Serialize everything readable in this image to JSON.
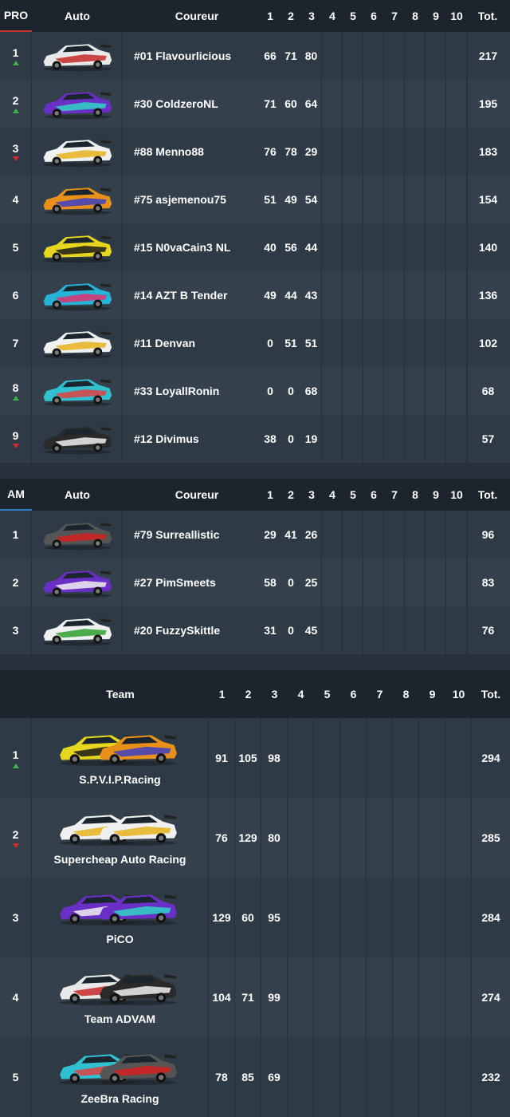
{
  "pro": {
    "header": {
      "category": "PRO",
      "auto": "Auto",
      "coureur": "Coureur",
      "races": [
        "1",
        "2",
        "3",
        "4",
        "5",
        "6",
        "7",
        "8",
        "9",
        "10"
      ],
      "total": "Tot."
    },
    "rows": [
      {
        "pos": "1",
        "trend": "up",
        "driver": "#01 Flavourlicious",
        "scores": [
          "66",
          "71",
          "80"
        ],
        "total": "217",
        "car": {
          "body": "#e8e8e8",
          "accent": "#c62828"
        }
      },
      {
        "pos": "2",
        "trend": "up",
        "driver": "#30 ColdzeroNL",
        "scores": [
          "71",
          "60",
          "64"
        ],
        "total": "195",
        "car": {
          "body": "#6a2fc4",
          "accent": "#2ed3c5"
        }
      },
      {
        "pos": "3",
        "trend": "down",
        "driver": "#88 Menno88",
        "scores": [
          "76",
          "78",
          "29"
        ],
        "total": "183",
        "car": {
          "body": "#f0f0f0",
          "accent": "#e6b41e"
        }
      },
      {
        "pos": "4",
        "trend": "none",
        "driver": "#75 asjemenou75",
        "scores": [
          "51",
          "49",
          "54"
        ],
        "total": "154",
        "car": {
          "body": "#e8901a",
          "accent": "#3d3fc4"
        }
      },
      {
        "pos": "5",
        "trend": "none",
        "driver": "#15 N0vaCain3 NL",
        "scores": [
          "40",
          "56",
          "44"
        ],
        "total": "140",
        "car": {
          "body": "#e6d61e",
          "accent": "#1a1a1a"
        }
      },
      {
        "pos": "6",
        "trend": "none",
        "driver": "#14 AZT B Tender",
        "scores": [
          "49",
          "44",
          "43"
        ],
        "total": "136",
        "car": {
          "body": "#24b4d8",
          "accent": "#e03070"
        }
      },
      {
        "pos": "7",
        "trend": "none",
        "driver": "#11 Denvan",
        "scores": [
          "0",
          "51",
          "51"
        ],
        "total": "102",
        "car": {
          "body": "#f0f0f0",
          "accent": "#e6b41e"
        }
      },
      {
        "pos": "8",
        "trend": "up",
        "driver": "#33 LoyallRonin",
        "scores": [
          "0",
          "0",
          "68"
        ],
        "total": "68",
        "car": {
          "body": "#30c0d0",
          "accent": "#e04040"
        }
      },
      {
        "pos": "9",
        "trend": "down",
        "driver": "#12 Divimus",
        "scores": [
          "38",
          "0",
          "19"
        ],
        "total": "57",
        "car": {
          "body": "#2a2a2a",
          "accent": "#f0f0f0"
        }
      }
    ]
  },
  "am": {
    "header": {
      "category": "AM",
      "auto": "Auto",
      "coureur": "Coureur",
      "races": [
        "1",
        "2",
        "3",
        "4",
        "5",
        "6",
        "7",
        "8",
        "9",
        "10"
      ],
      "total": "Tot."
    },
    "rows": [
      {
        "pos": "1",
        "trend": "none",
        "driver": "#79 Surreallistic",
        "scores": [
          "29",
          "41",
          "26"
        ],
        "total": "96",
        "car": {
          "body": "#555555",
          "accent": "#d62020"
        }
      },
      {
        "pos": "2",
        "trend": "none",
        "driver": "#27 PimSmeets",
        "scores": [
          "58",
          "0",
          "25"
        ],
        "total": "83",
        "car": {
          "body": "#6a2fc4",
          "accent": "#f0f0f0"
        }
      },
      {
        "pos": "3",
        "trend": "none",
        "driver": "#20 FuzzySkittle",
        "scores": [
          "31",
          "0",
          "45"
        ],
        "total": "76",
        "car": {
          "body": "#f0f0f0",
          "accent": "#30a030"
        }
      }
    ]
  },
  "team": {
    "header": {
      "team": "Team",
      "races": [
        "1",
        "2",
        "3",
        "4",
        "5",
        "6",
        "7",
        "8",
        "9",
        "10"
      ],
      "total": "Tot."
    },
    "rows": [
      {
        "pos": "1",
        "trend": "up",
        "name": "S.P.V.I.P.Racing",
        "scores": [
          "91",
          "105",
          "98"
        ],
        "total": "294",
        "cars": [
          {
            "body": "#e6d61e",
            "accent": "#1a1a1a"
          },
          {
            "body": "#e8901a",
            "accent": "#3d3fc4"
          }
        ]
      },
      {
        "pos": "2",
        "trend": "down",
        "name": "Supercheap Auto Racing",
        "scores": [
          "76",
          "129",
          "80"
        ],
        "total": "285",
        "cars": [
          {
            "body": "#f0f0f0",
            "accent": "#e6b41e"
          },
          {
            "body": "#f0f0f0",
            "accent": "#e6b41e"
          }
        ]
      },
      {
        "pos": "3",
        "trend": "none",
        "name": "PiCO",
        "scores": [
          "129",
          "60",
          "95"
        ],
        "total": "284",
        "cars": [
          {
            "body": "#6a2fc4",
            "accent": "#f0f0f0"
          },
          {
            "body": "#6a2fc4",
            "accent": "#2ed3c5"
          }
        ]
      },
      {
        "pos": "4",
        "trend": "none",
        "name": "Team ADVAM",
        "scores": [
          "104",
          "71",
          "99"
        ],
        "total": "274",
        "cars": [
          {
            "body": "#e8e8e8",
            "accent": "#c62828"
          },
          {
            "body": "#2a2a2a",
            "accent": "#f0f0f0"
          }
        ]
      },
      {
        "pos": "5",
        "trend": "none",
        "name": "ZeeBra Racing",
        "scores": [
          "78",
          "85",
          "69"
        ],
        "total": "232",
        "cars": [
          {
            "body": "#30c0d0",
            "accent": "#e04040"
          },
          {
            "body": "#555555",
            "accent": "#d62020"
          }
        ]
      }
    ]
  }
}
